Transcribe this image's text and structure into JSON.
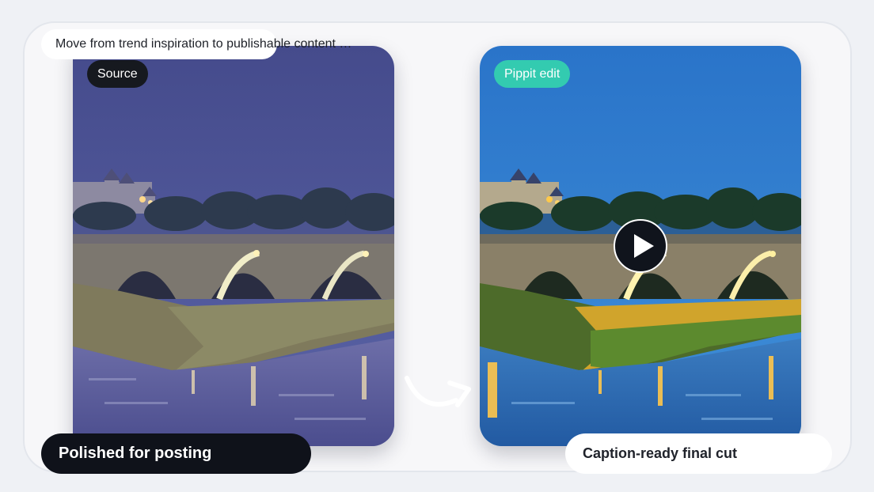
{
  "prompt": {
    "text": "Move from trend inspiration to publishable content f..."
  },
  "source_card": {
    "badge": "Source",
    "image": "night view of an illuminated stone arch bridge over a river with a castle on the hill"
  },
  "edit_card": {
    "badge": "Pippit edit",
    "image": "color-enhanced version of the same bridge and castle scene",
    "play_icon": "play-icon"
  },
  "captions": {
    "left": "Polished for posting",
    "right": "Caption-ready final cut"
  },
  "colors": {
    "edit_badge": "#33cbb0",
    "dark_pill": "#0f121a",
    "source_badge": "#16191f"
  }
}
